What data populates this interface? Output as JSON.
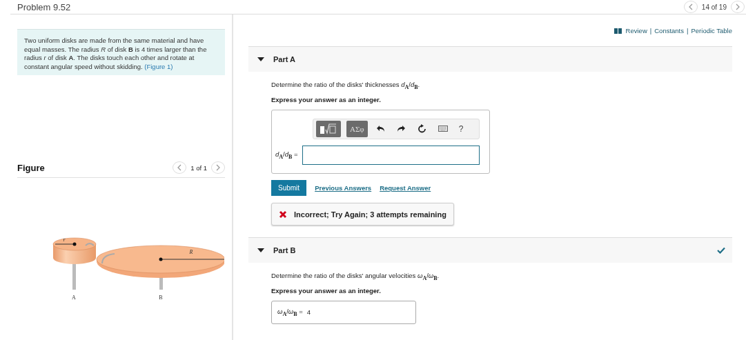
{
  "header": {
    "title": "Problem 9.52",
    "pager": "14 of 19"
  },
  "intro": {
    "text": "Two uniform disks are made from the same material and have equal masses. The radius *R* of disk **B** is 4 times larger than the radius *r* of disk **A**. The disks touch each other and rotate at constant angular speed without skidding.",
    "link": "(Figure 1)"
  },
  "figure": {
    "title": "Figure",
    "pager": "1 of 1",
    "labels": [
      "r",
      "R",
      "A",
      "B"
    ]
  },
  "links": [
    "Review",
    "Constants",
    "Periodic Table"
  ],
  "link_separator": "|",
  "parts": [
    {
      "title": "Part A",
      "expanded": true,
      "correct": false,
      "question": "Determine the ratio of the disks' thicknesses *d*$_{A}$/*d*$_{B}$.",
      "instruction": "Express your answer as an integer.",
      "answer_label": "*d*$_{A}$/*d*$_{B}$ =",
      "kind": "editor",
      "toolbar": {
        "greek": "ΑΣφ",
        "help": "?"
      },
      "buttons": [
        "Submit"
      ],
      "links": [
        "Previous Answers",
        "Request Answer"
      ],
      "feedback": {
        "kind": "incorrect",
        "text": "Incorrect; Try Again; 3 attempts remaining"
      }
    },
    {
      "title": "Part B",
      "expanded": true,
      "correct": true,
      "question": "Determine the ratio of the disks' angular velocities *ω*$_{A}$/*ω*$_{B}$.",
      "instruction": "Express your answer as an integer.",
      "answer_label": "*ω*$_{A}$/*ω*$_{B}$ =",
      "kind": "answered",
      "answer_value": "4"
    }
  ]
}
